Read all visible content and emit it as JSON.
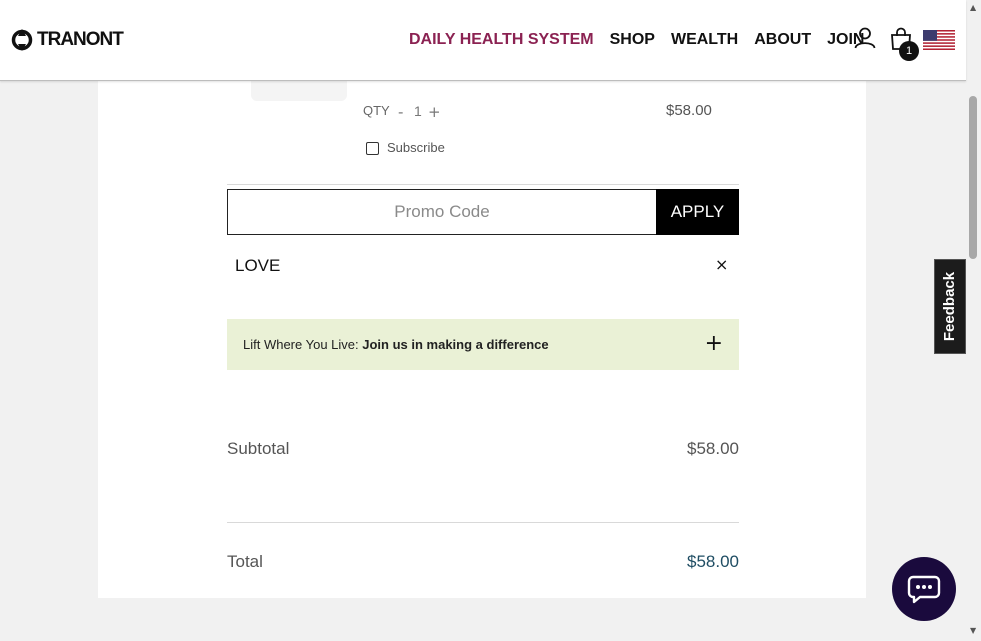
{
  "header": {
    "logo_text": "TRANONT",
    "nav": [
      "DAILY HEALTH SYSTEM",
      "SHOP",
      "WEALTH",
      "ABOUT",
      "JOIN"
    ],
    "cart_count": "1",
    "accent_color": "#8b2252"
  },
  "cart_item": {
    "qty_label": "QTY",
    "qty_minus": "-",
    "qty_value": "1",
    "qty_plus": "+",
    "price": "$58.00",
    "subscribe_label": "Subscribe"
  },
  "promo": {
    "placeholder": "Promo Code",
    "apply_label": "APPLY",
    "applied_code": "LOVE",
    "remove_symbol": "×"
  },
  "lift": {
    "prefix": "Lift Where You Live: ",
    "emphasis": "Join us in making a difference",
    "toggle_symbol": "+"
  },
  "summary": {
    "subtotal_label": "Subtotal",
    "subtotal_value": "$58.00",
    "total_label": "Total",
    "total_value": "$58.00",
    "total_color": "#1f4d63"
  },
  "feedback_label": "Feedback"
}
